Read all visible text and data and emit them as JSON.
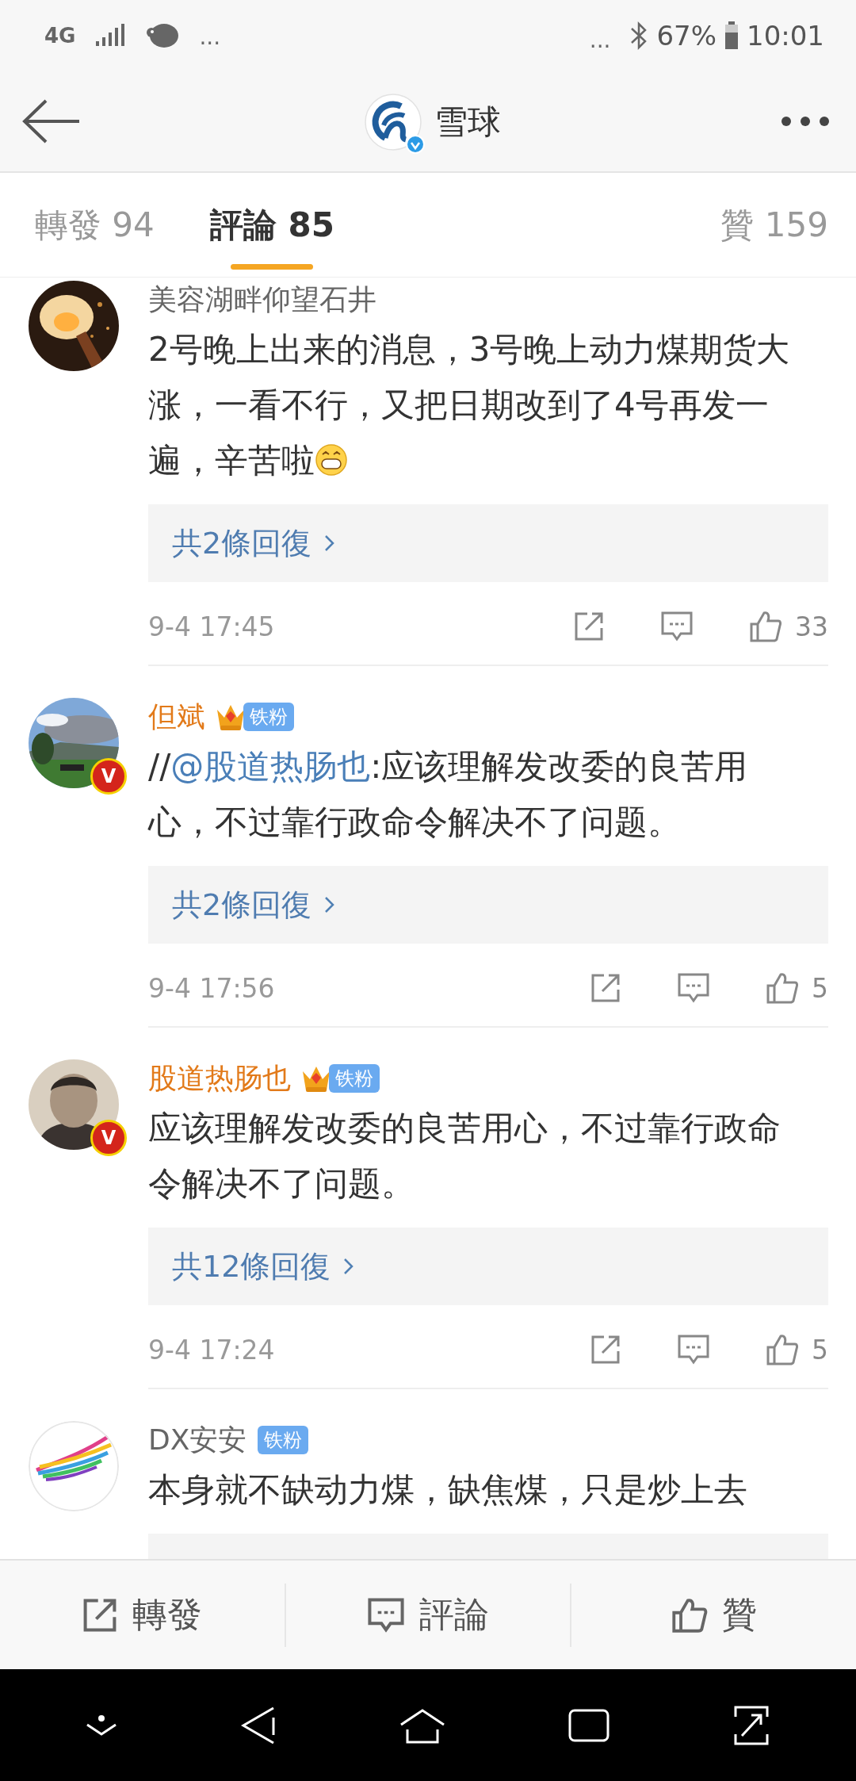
{
  "status_bar": {
    "network": "4G",
    "more": "···",
    "right_more": "···",
    "battery": "67%",
    "time": "10:01"
  },
  "header": {
    "title": "雪球"
  },
  "tabs": [
    {
      "label": "轉發 94",
      "selected": false
    },
    {
      "label": "評論 85",
      "selected": true
    },
    {
      "label": "贊 159",
      "selected": false
    }
  ],
  "comments": [
    {
      "author": "美容湖畔仰望石井",
      "vip": false,
      "body": [
        {
          "kind": "text",
          "text": "2号晚上出来的消息，3号晚上动力煤期货大涨，一看不行，又把日期改到了4号再发一遍，辛苦啦"
        },
        {
          "kind": "emoji"
        }
      ],
      "replies": "共2條回復",
      "time": "9-4 17:45",
      "likes": "33"
    },
    {
      "author": "但斌",
      "vip": true,
      "crown": true,
      "badge": "铁粉",
      "verified": "V",
      "body": [
        {
          "kind": "text",
          "text": "//"
        },
        {
          "kind": "mention",
          "text": "@股道热肠也"
        },
        {
          "kind": "text",
          "text": ":应该理解发改委的良苦用心，不过靠行政命令解决不了问题。"
        }
      ],
      "replies": "共2條回復",
      "time": "9-4 17:56",
      "likes": "5"
    },
    {
      "author": "股道热肠也",
      "vip": true,
      "crown": true,
      "badge": "铁粉",
      "verified": "V",
      "body": [
        {
          "kind": "text",
          "text": "应该理解发改委的良苦用心，不过靠行政命令解决不了问题。"
        }
      ],
      "replies": "共12條回復",
      "time": "9-4 17:24",
      "likes": "5"
    },
    {
      "author": "DX安安",
      "vip": false,
      "badge": "铁粉",
      "body": [
        {
          "kind": "text",
          "text": "本身就不缺动力煤，缺焦煤，只是炒上去"
        }
      ]
    }
  ],
  "actions": [
    {
      "kind": "share",
      "label": "轉發"
    },
    {
      "kind": "comment",
      "label": "評論"
    },
    {
      "kind": "like",
      "label": "贊"
    }
  ]
}
